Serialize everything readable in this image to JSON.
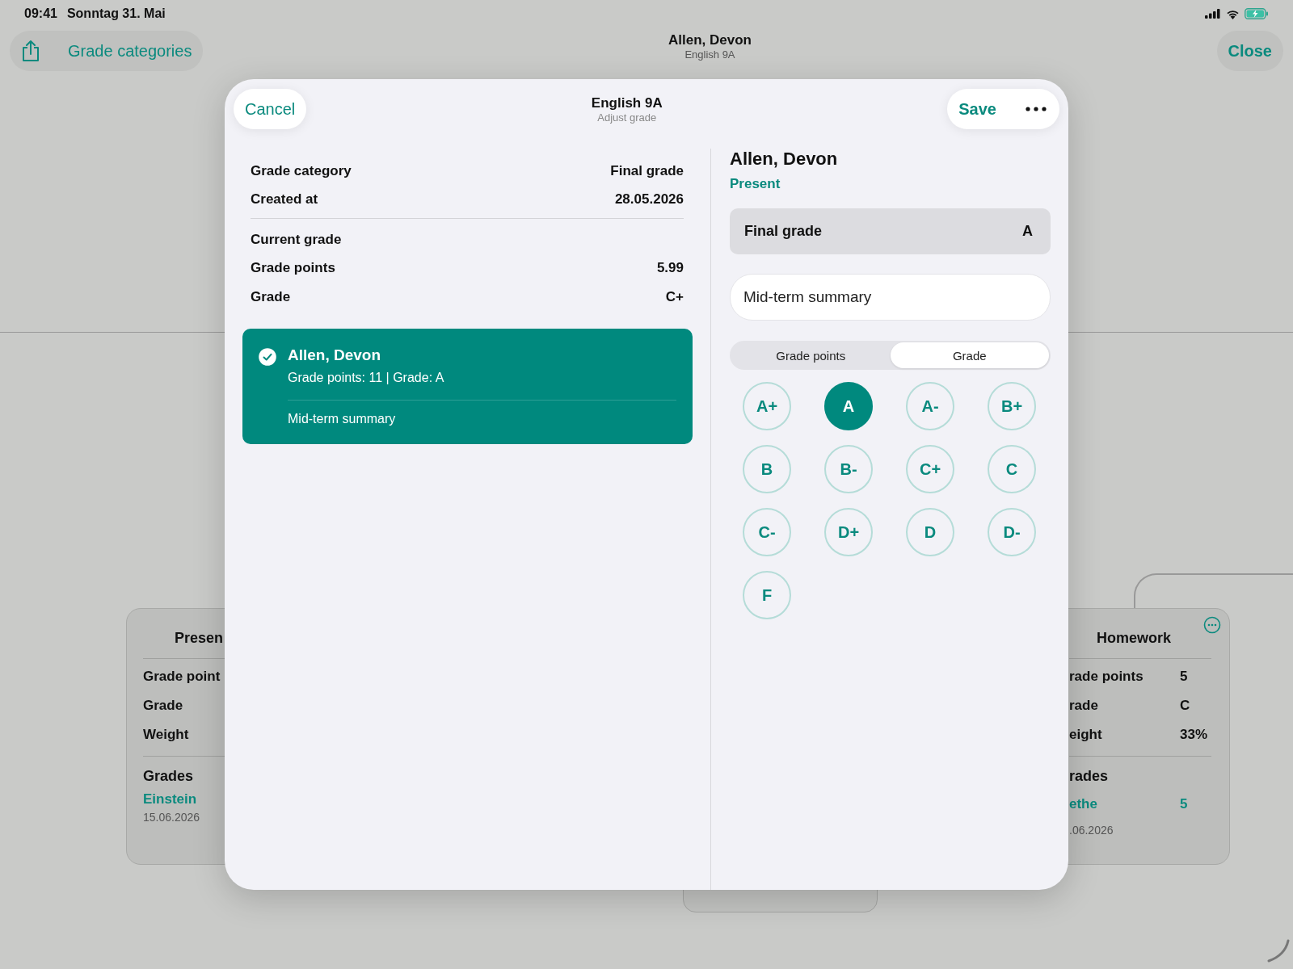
{
  "status_bar": {
    "time": "09:41",
    "date": "Sonntag 31. Mai"
  },
  "nav": {
    "back_button": "Grade categories",
    "title": "Allen, Devon",
    "subtitle": "English 9A",
    "close_button": "Close"
  },
  "left_card": {
    "title": "Presen",
    "rows": [
      {
        "label": "Grade point"
      },
      {
        "label": "Grade"
      },
      {
        "label": "Weight"
      }
    ],
    "section": "Grades",
    "entry": {
      "name": "Einstein",
      "date": "15.06.2026"
    }
  },
  "right_card": {
    "title": "Homework",
    "rows": [
      {
        "label": "rade points",
        "value": "5"
      },
      {
        "label": "rade",
        "value": "C"
      },
      {
        "label": "eight",
        "value": "33%"
      }
    ],
    "section": "rades",
    "entry": {
      "name": "ethe",
      "date": ".06.2026",
      "value": "5"
    }
  },
  "sheet": {
    "cancel_button": "Cancel",
    "title": "English 9A",
    "subtitle": "Adjust grade",
    "save_button": "Save",
    "details": [
      {
        "label": "Grade category",
        "value": "Final grade"
      },
      {
        "label": "Created at",
        "value": "28.05.2026"
      }
    ],
    "current_grade": {
      "heading": "Current grade",
      "rows": [
        {
          "label": "Grade points",
          "value": "5.99"
        },
        {
          "label": "Grade",
          "value": "C+"
        }
      ]
    },
    "entry": {
      "checked": true,
      "name": "Allen, Devon",
      "summary": "Grade points: 11 | Grade: A",
      "note": "Mid-term summary"
    },
    "student": {
      "name": "Allen, Devon",
      "status": "Present"
    },
    "category": {
      "label": "Final grade",
      "value": "A"
    },
    "comment": {
      "value": "Mid-term summary"
    },
    "mode_tabs": [
      {
        "label": "Grade points",
        "selected": false
      },
      {
        "label": "Grade",
        "selected": true
      }
    ],
    "grades": [
      {
        "label": "A+",
        "selected": false
      },
      {
        "label": "A",
        "selected": true
      },
      {
        "label": "A-",
        "selected": false
      },
      {
        "label": "B+",
        "selected": false
      },
      {
        "label": "B",
        "selected": false
      },
      {
        "label": "B-",
        "selected": false
      },
      {
        "label": "C+",
        "selected": false
      },
      {
        "label": "C",
        "selected": false
      },
      {
        "label": "C-",
        "selected": false
      },
      {
        "label": "D+",
        "selected": false
      },
      {
        "label": "D",
        "selected": false
      },
      {
        "label": "D-",
        "selected": false
      },
      {
        "label": "F",
        "selected": false
      }
    ]
  }
}
